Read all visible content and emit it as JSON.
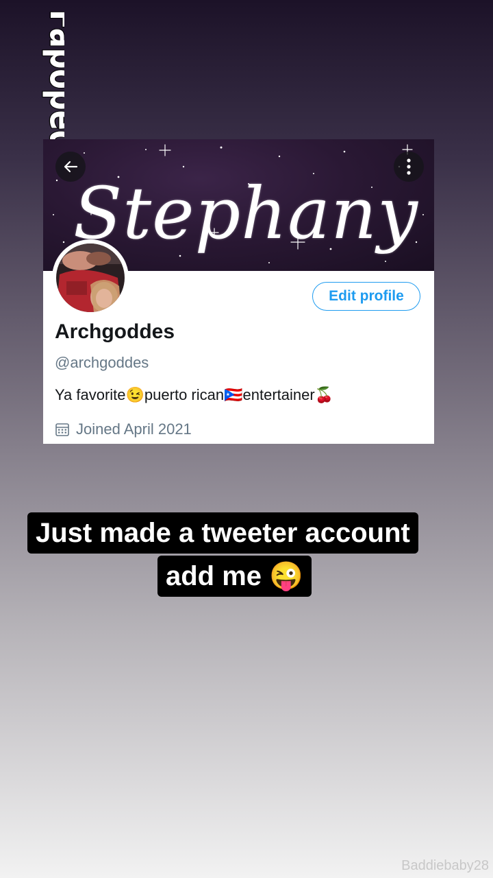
{
  "watermark": {
    "text": "Fapopedia"
  },
  "profile": {
    "banner_text": "Stephany",
    "edit_button": "Edit profile",
    "display_name": "Archgoddes",
    "handle": "@archgoddes",
    "bio": "Ya favorite😉puerto rican🇵🇷entertainer🍒",
    "joined": "Joined April 2021",
    "accent_color": "#1d9bf0"
  },
  "story": {
    "caption_line1": "Just made a tweeter account",
    "caption_line2": "add me 😜",
    "credit": "Baddiebaby28"
  },
  "icons": [
    "back-arrow-icon",
    "more-options-icon",
    "calendar-icon"
  ]
}
